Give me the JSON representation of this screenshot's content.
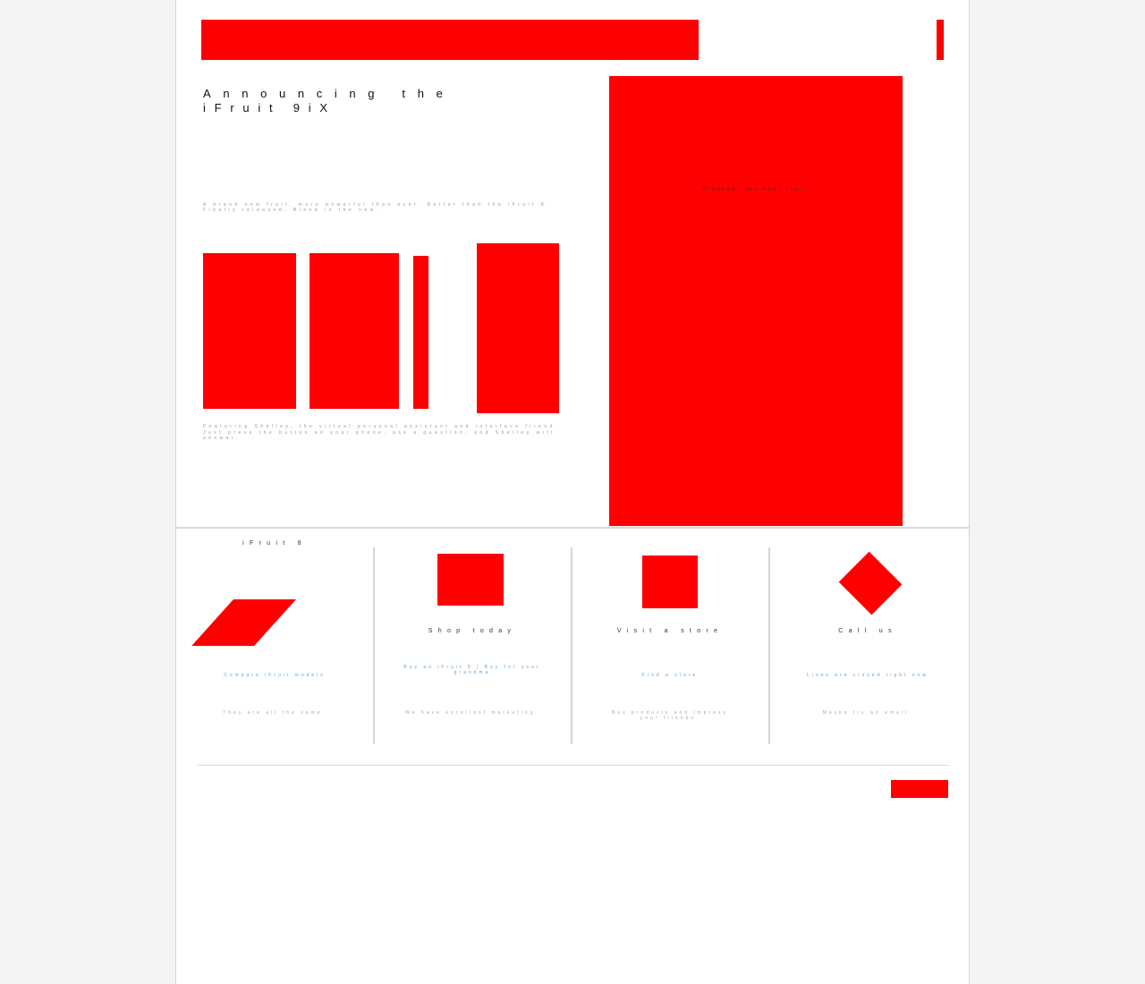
{
  "hero": {
    "title_line1": "Announcing the",
    "title_line2": "iFruit 9iX",
    "subtitle": "A brand new fruit, more powerful than ever. Better than the iFruit 8. Finally released. Blend in the new.",
    "feature_note": "Featuring Shelley, the virtual personal assistant and interface friend. Just press the button on your phone, ask a question, and Shelley will answer.",
    "overlay_caption": "Discover the best fruit"
  },
  "columns": [
    {
      "title": "iFruit 8",
      "link": "Compare iFruit models",
      "note": "They are all the same."
    },
    {
      "title": "Shop today",
      "link": "Buy an iFruit 9 | Buy for your grandma",
      "note": "We have excellent marketing."
    },
    {
      "title": "Visit a store",
      "link": "Find a store",
      "note": "Buy products and impress your friends."
    },
    {
      "title": "Call us",
      "link": "Lines are closed right now",
      "note": "Maybe try an email."
    }
  ],
  "colors": {
    "placeholder": "#ff0000",
    "link": "#5aa3e0",
    "divider": "#d9d9d9"
  }
}
